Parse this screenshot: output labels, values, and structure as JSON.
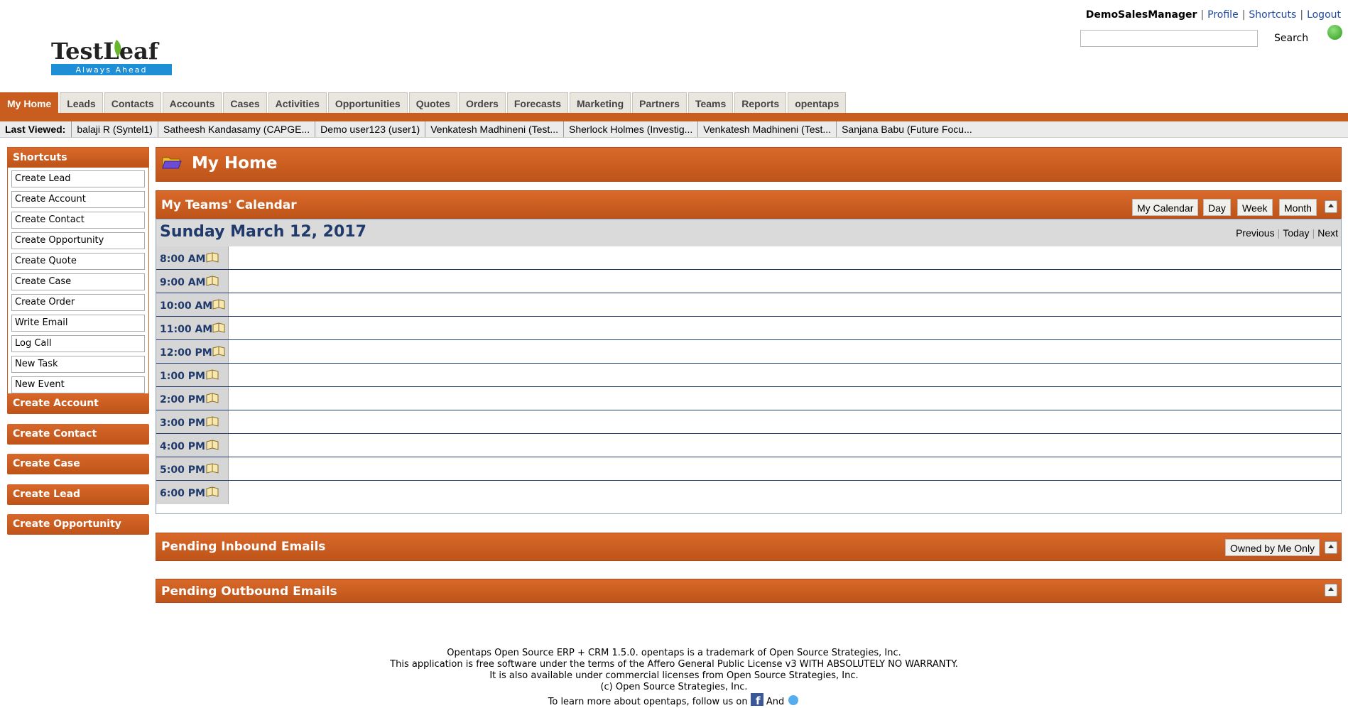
{
  "logo": {
    "name": "TestLeaf",
    "tagline": "Always Ahead"
  },
  "userbar": {
    "user": "DemoSalesManager",
    "links": [
      "Profile",
      "Shortcuts",
      "Logout"
    ]
  },
  "search": {
    "label": "Search",
    "value": ""
  },
  "tabs": [
    "My Home",
    "Leads",
    "Contacts",
    "Accounts",
    "Cases",
    "Activities",
    "Opportunities",
    "Quotes",
    "Orders",
    "Forecasts",
    "Marketing",
    "Partners",
    "Teams",
    "Reports",
    "opentaps"
  ],
  "active_tab": "My Home",
  "last_viewed": {
    "label": "Last Viewed:",
    "items": [
      "balaji R (Syntel1)",
      "Satheesh Kandasamy (CAPGE...",
      "Demo user123 (user1)",
      "Venkatesh Madhineni (Test...",
      "Sherlock Holmes (Investig...",
      "Venkatesh Madhineni (Test...",
      "Sanjana Babu (Future Focu..."
    ]
  },
  "shortcuts": {
    "title": "Shortcuts",
    "items": [
      "Create Lead",
      "Create Account",
      "Create Contact",
      "Create Opportunity",
      "Create Quote",
      "Create Case",
      "Create Order",
      "Write Email",
      "Log Call",
      "New Task",
      "New Event"
    ]
  },
  "side_buttons": [
    "Create Account",
    "Create Contact",
    "Create Case",
    "Create Lead",
    "Create Opportunity"
  ],
  "page_title": "My Home",
  "calendar": {
    "title": "My Teams' Calendar",
    "buttons": [
      "My Calendar",
      "Day",
      "Week",
      "Month"
    ],
    "date": "Sunday March 12, 2017",
    "nav": [
      "Previous",
      "Today",
      "Next"
    ],
    "slots": [
      "8:00 AM",
      "9:00 AM",
      "10:00 AM",
      "11:00 AM",
      "12:00 PM",
      "1:00 PM",
      "2:00 PM",
      "3:00 PM",
      "4:00 PM",
      "5:00 PM",
      "6:00 PM"
    ]
  },
  "inbound": {
    "title": "Pending Inbound Emails",
    "filter_button": "Owned by Me Only"
  },
  "outbound": {
    "title": "Pending Outbound Emails"
  },
  "footer": {
    "lines": [
      "Opentaps Open Source ERP + CRM 1.5.0. opentaps is a trademark of Open Source Strategies, Inc.",
      "This application is free software under the terms of the Affero General Public License v3 WITH ABSOLUTELY NO WARRANTY.",
      "It is also available under commercial licenses from Open Source Strategies, Inc.",
      "(c) Open Source Strategies, Inc."
    ],
    "follow_prefix": "To learn more about opentaps, follow us on",
    "follow_and": "And"
  },
  "colors": {
    "accent": "#c85d1f",
    "navy": "#1f3a6b",
    "link": "#1f4a9c"
  }
}
